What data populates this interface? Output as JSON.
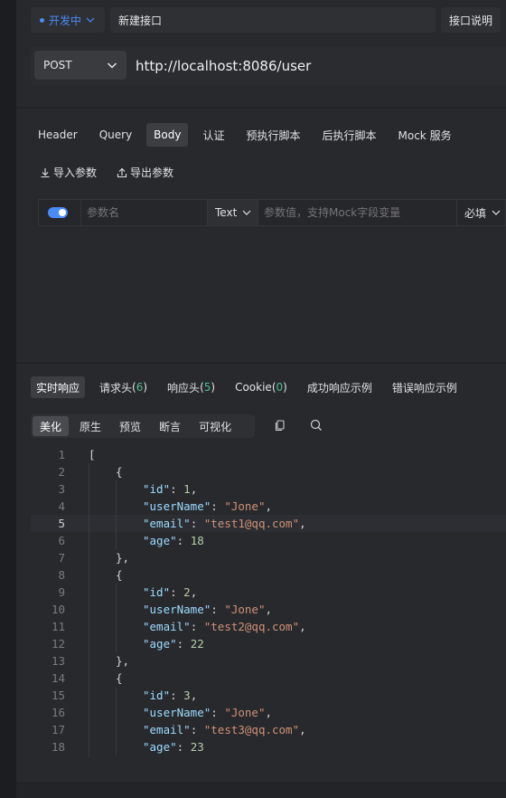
{
  "header": {
    "environment": "开发中",
    "api_name": "新建接口",
    "doc_button": "接口说明"
  },
  "request": {
    "method": "POST",
    "url": "http://localhost:8086/user"
  },
  "request_tabs": [
    "Header",
    "Query",
    "Body",
    "认证",
    "预执行脚本",
    "后执行脚本",
    "Mock 服务"
  ],
  "active_request_tab": "Body",
  "body_actions": {
    "import": "导入参数",
    "export": "导出参数"
  },
  "param_row": {
    "enabled": true,
    "name_placeholder": "参数名",
    "type": "Text",
    "value_placeholder": "参数值，支持Mock字段变量",
    "required": "必填"
  },
  "response_tabs": {
    "realtime": "实时响应",
    "request_headers_label": "请求头",
    "request_headers_count": "6",
    "response_headers_label": "响应头",
    "response_headers_count": "5",
    "cookie_label": "Cookie",
    "cookie_count": "0",
    "success_example": "成功响应示例",
    "error_example": "错误响应示例"
  },
  "view_modes": [
    "美化",
    "原生",
    "预览",
    "断言",
    "可视化"
  ],
  "active_view_mode": "美化",
  "code": {
    "current_line": 5,
    "records": [
      {
        "id": 1,
        "userName": "Jone",
        "email": "test1@qq.com",
        "age": 18
      },
      {
        "id": 2,
        "userName": "Jone",
        "email": "test2@qq.com",
        "age": 22
      },
      {
        "id": 3,
        "userName": "Jone",
        "email": "test3@qq.com",
        "age": 23
      }
    ]
  },
  "colors": {
    "accent": "#4a8cf7",
    "count": "#4fc08d",
    "json_key": "#9cdcfe",
    "json_string": "#ce9178",
    "json_number": "#b5cea8"
  }
}
